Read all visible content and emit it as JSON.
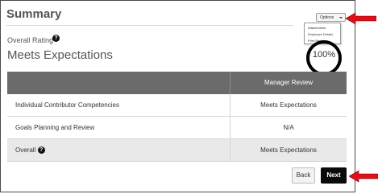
{
  "header": {
    "title": "Summary"
  },
  "options": {
    "button_label": "Options",
    "menu_items": [
      "Attachments",
      "Employee Details",
      "Print Review"
    ]
  },
  "rating": {
    "label": "Overall Rating",
    "value": "Meets Expectations",
    "percent": "100%"
  },
  "table": {
    "header": "Manager Review",
    "rows": [
      {
        "label": "Individual Contributor Competencies",
        "value": "Meets Expectations"
      },
      {
        "label": "Goals Planning and Review",
        "value": "N/A"
      },
      {
        "label": "Overall",
        "value": "Meets Expectations"
      }
    ]
  },
  "footer": {
    "back_label": "Back",
    "next_label": "Next"
  },
  "colors": {
    "annotation_arrow": "#e0101a",
    "table_header": "#6b6b6b",
    "primary_button": "#0a0a0a"
  }
}
